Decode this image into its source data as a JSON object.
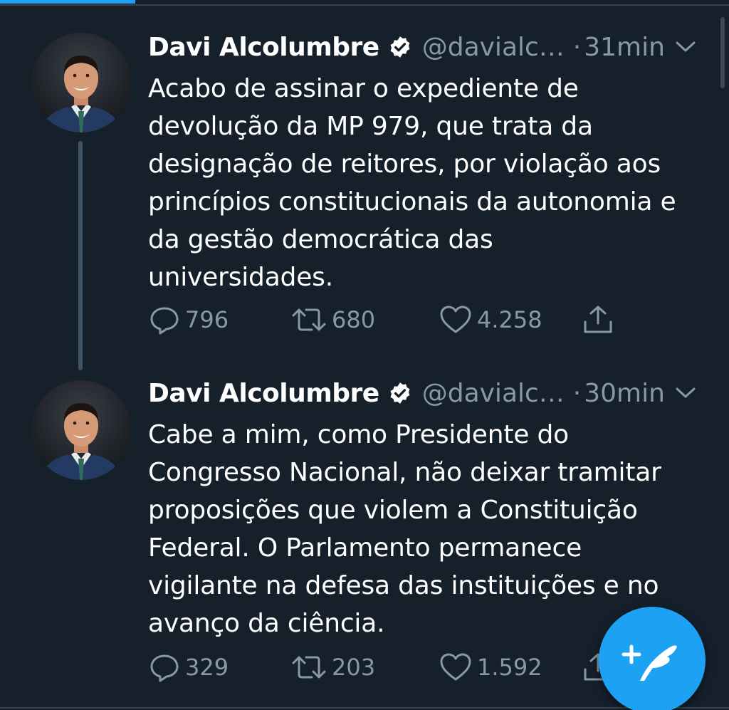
{
  "colors": {
    "background": "#15202b",
    "accent": "#1da1f2",
    "secondary_text": "#8899a6",
    "primary_text": "#ffffff"
  },
  "tweets": [
    {
      "author": {
        "display_name": "Davi Alcolumbre",
        "handle": "@davialc…",
        "verified": true,
        "avatar": "portrait-avatar"
      },
      "time_separator": "·",
      "time": "31min",
      "text": "Acabo de assinar o expediente de\ndevolução da MP 979, que trata da\ndesignação de reitores, por violação aos\nprincípios constitucionais da autonomia e\nda gestão democrática das\nuniversidades.",
      "actions": {
        "replies": "796",
        "retweets": "680",
        "likes": "4.258"
      }
    },
    {
      "author": {
        "display_name": "Davi Alcolumbre",
        "handle": "@davialc…",
        "verified": true,
        "avatar": "portrait-avatar"
      },
      "time_separator": "·",
      "time": "30min",
      "text": "Cabe a mim, como Presidente do\nCongresso Nacional, não deixar tramitar\nproposições que violem a Constituição\nFederal. O Parlamento permanece\nvigilante na defesa das instituições e no\navanço da ciência.",
      "actions": {
        "replies": "329",
        "retweets": "203",
        "likes": "1.592"
      }
    }
  ],
  "icons": {
    "reply": "reply-icon",
    "retweet": "retweet-icon",
    "like": "heart-icon",
    "share": "share-icon",
    "caret": "chevron-down-icon",
    "verified": "verified-badge-icon",
    "compose": "compose-tweet-icon"
  }
}
